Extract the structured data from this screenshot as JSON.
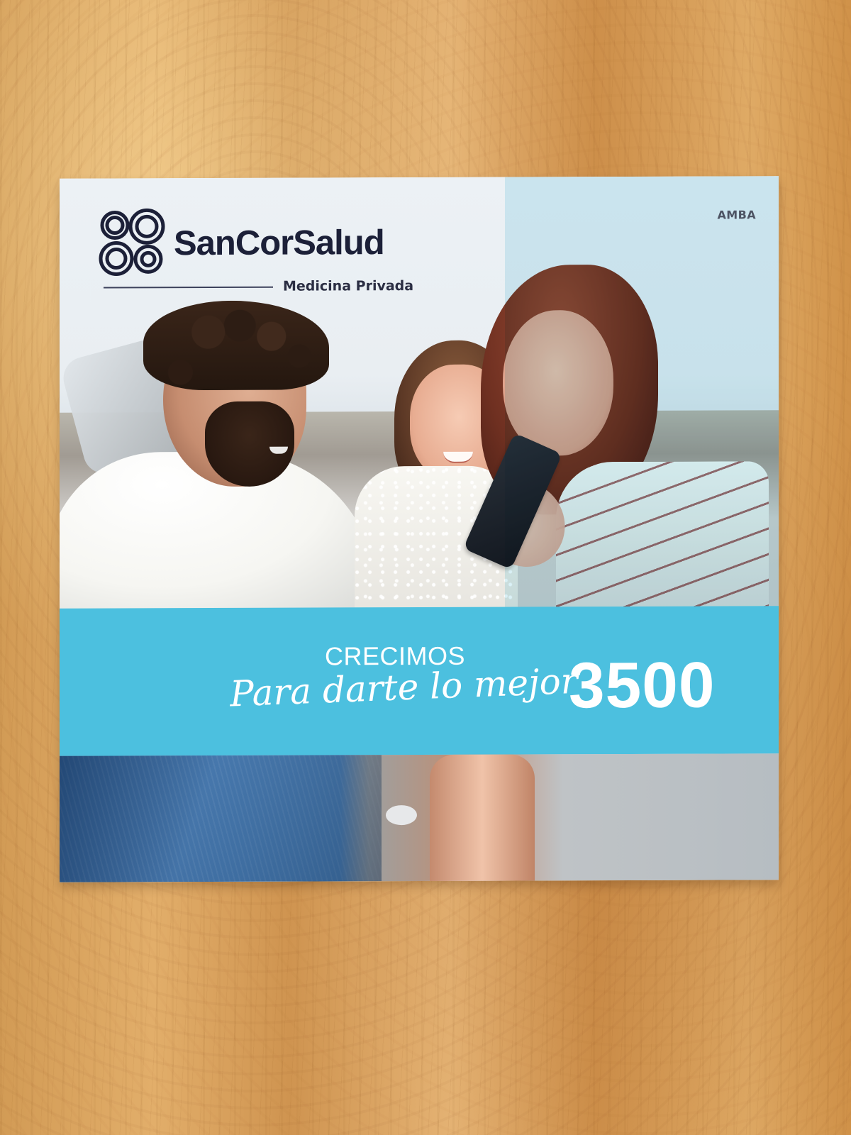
{
  "brochure": {
    "brand": "SanCorSalud",
    "subtitle": "Medicina Privada",
    "region": "AMBA",
    "banner": {
      "line1": "CRECIMOS",
      "line2": "Para darte lo mejor",
      "number": "3500"
    }
  },
  "colors": {
    "brand_navy": "#1c2038",
    "banner_blue": "#4cc0df",
    "wood": "#d69f5b"
  },
  "icons": {
    "logo": "sancorsalud-logo-icon"
  }
}
